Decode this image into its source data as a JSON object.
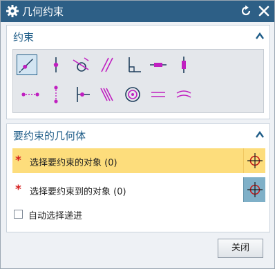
{
  "dialog": {
    "title": "几何约束",
    "icons": {
      "gear": "gear-icon",
      "reset": "reset-icon",
      "close": "close-icon"
    }
  },
  "constraints_section": {
    "title": "约束",
    "collapse_icon": "chevron-up-icon",
    "buttons": [
      {
        "name": "point-on-curve-constraint-icon"
      },
      {
        "name": "point-on-line-constraint-icon"
      },
      {
        "name": "tangent-constraint-icon"
      },
      {
        "name": "parallel-constraint-icon"
      },
      {
        "name": "perpendicular-constraint-icon"
      },
      {
        "name": "horizontal-constraint-icon"
      },
      {
        "name": "vertical-constraint-icon"
      },
      {
        "name": "horizontal-alignment-constraint-icon"
      },
      {
        "name": "vertical-alignment-constraint-icon"
      },
      {
        "name": "midpoint-constraint-icon"
      },
      {
        "name": "collinear-constraint-icon"
      },
      {
        "name": "concentric-constraint-icon"
      },
      {
        "name": "equal-length-constraint-icon"
      },
      {
        "name": "equal-radius-constraint-icon"
      }
    ]
  },
  "geometry_section": {
    "title": "要约束的几何体",
    "collapse_icon": "chevron-up-icon",
    "select_object": {
      "required_mark": "*",
      "label": "选择要约束的对象 (0)"
    },
    "select_target": {
      "required_mark": "*",
      "label": "选择要约束到的对象 (0)"
    },
    "auto_select": {
      "label": "自动选择递进",
      "checked": false
    }
  },
  "footer": {
    "close_label": "关闭"
  },
  "colors": {
    "titlebar": "#2d5f86",
    "section_title": "#1f5d88",
    "active_row": "#fddd7c",
    "required_mark": "#d62020",
    "icon_magenta": "#c020c0",
    "pick_blue": "#7fb0c8"
  }
}
